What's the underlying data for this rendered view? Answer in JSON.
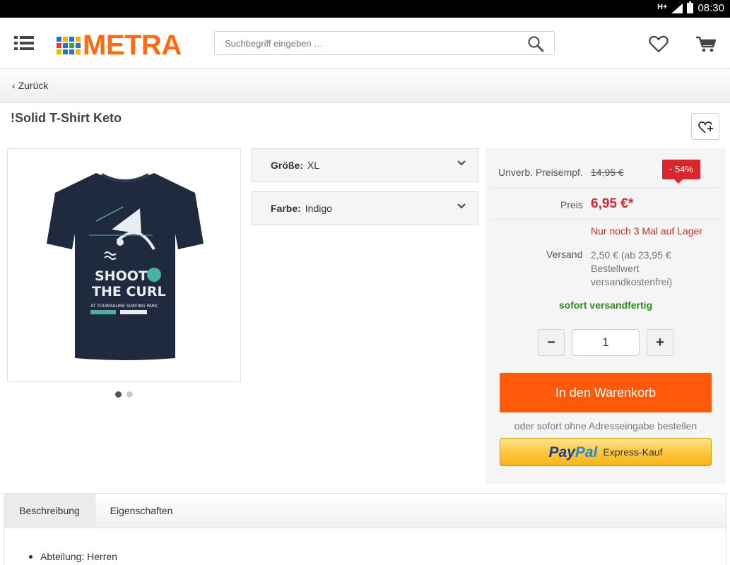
{
  "status_bar": {
    "network": "H+",
    "time": "08:30"
  },
  "header": {
    "logo_text": "METRA",
    "logo_colors": [
      "#2b6fd6",
      "#f4b400",
      "#2b6fd6",
      "#f4b400",
      "#e53935",
      "#2b6fd6",
      "#43a047",
      "#2b6fd6",
      "#f4b400",
      "#2b6fd6",
      "#2b6fd6",
      "#f4b400"
    ],
    "search_placeholder": "Suchbegriff eingeben …"
  },
  "nav": {
    "back_label": "Zurück"
  },
  "product": {
    "title": "!Solid T-Shirt Keto",
    "image_dots": 2,
    "active_dot": 0,
    "variants": [
      {
        "label": "Größe:",
        "value": "XL"
      },
      {
        "label": "Farbe:",
        "value": "Indigo"
      }
    ]
  },
  "buybox": {
    "uvp_label": "Unverb. Preisempf.",
    "uvp_value": "14,95 €",
    "discount": "- 54%",
    "price_label": "Preis",
    "price_value": "6,95 €*",
    "stock_text": "Nur noch 3 Mal auf Lager",
    "shipping_label": "Versand",
    "shipping_value": "2,50 € (ab 23,95 € Bestellwert versandkostenfrei)",
    "ready_text": "sofort versandfertig",
    "quantity": "1",
    "minus": "−",
    "plus": "+",
    "cart_button": "In den Warenkorb",
    "or_text": "oder sofort ohne Adresseingabe bestellen",
    "paypal_part1": "Pay",
    "paypal_part2": "Pal",
    "paypal_express": "Express-Kauf"
  },
  "tabs": [
    {
      "label": "Beschreibung",
      "active": true
    },
    {
      "label": "Eigenschaften",
      "active": false
    }
  ],
  "description": {
    "items": [
      "Abteilung: Herren"
    ]
  },
  "colors": {
    "accent": "#ff5a0a",
    "sale": "#d9262c",
    "ready": "#2e8b1e",
    "logo": "#ff6a13"
  }
}
